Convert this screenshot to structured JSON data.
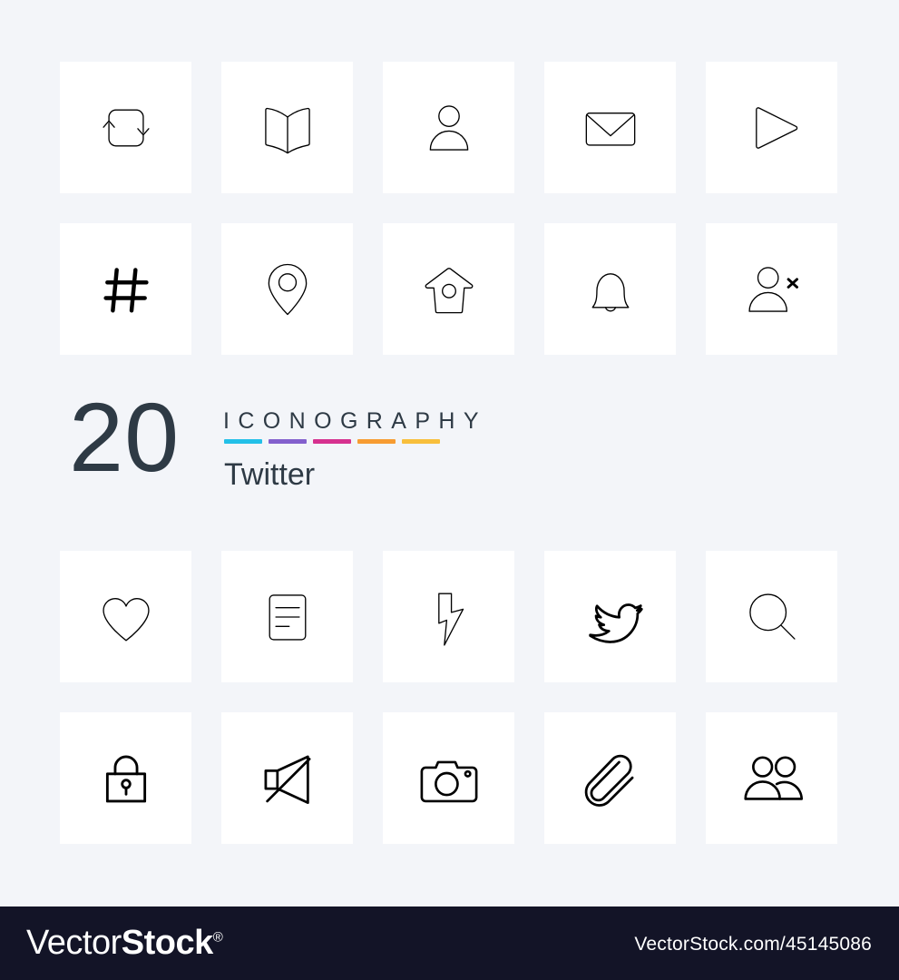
{
  "page": {
    "background_color": "#f3f5f9",
    "card_color": "#ffffff",
    "icon_stroke_color": "#000000"
  },
  "title_block": {
    "count": "20",
    "heading": "ICONOGRAPHY",
    "category": "Twitter",
    "text_color": "#2e3a45",
    "color_bars": [
      {
        "name": "bar-cyan",
        "color": "#23c0e8"
      },
      {
        "name": "bar-purple",
        "color": "#8360cd"
      },
      {
        "name": "bar-magenta",
        "color": "#d6318f"
      },
      {
        "name": "bar-orange",
        "color": "#f79c32"
      },
      {
        "name": "bar-yellow",
        "color": "#f8bf3c"
      }
    ]
  },
  "icons_top": [
    {
      "name": "retweet-icon",
      "label": "Retweet"
    },
    {
      "name": "book-icon",
      "label": "Book"
    },
    {
      "name": "user-icon",
      "label": "User"
    },
    {
      "name": "envelope-icon",
      "label": "Message"
    },
    {
      "name": "play-icon",
      "label": "Play"
    },
    {
      "name": "hashtag-icon",
      "label": "Hashtag"
    },
    {
      "name": "location-pin-icon",
      "label": "Location"
    },
    {
      "name": "birdhouse-icon",
      "label": "Birdhouse"
    },
    {
      "name": "bell-icon",
      "label": "Notification"
    },
    {
      "name": "user-remove-icon",
      "label": "Unfollow"
    }
  ],
  "icons_bottom": [
    {
      "name": "heart-icon",
      "label": "Like"
    },
    {
      "name": "document-icon",
      "label": "Document"
    },
    {
      "name": "lightning-icon",
      "label": "Moments"
    },
    {
      "name": "twitter-bird-icon",
      "label": "Twitter"
    },
    {
      "name": "search-icon",
      "label": "Search"
    },
    {
      "name": "lock-icon",
      "label": "Private"
    },
    {
      "name": "mute-icon",
      "label": "Mute"
    },
    {
      "name": "camera-icon",
      "label": "Camera"
    },
    {
      "name": "paperclip-icon",
      "label": "Attachment"
    },
    {
      "name": "users-group-icon",
      "label": "Followers"
    }
  ],
  "footer": {
    "brand_light": "Vector",
    "brand_bold": "Stock",
    "registered_mark": "®",
    "url": "VectorStock.com/45145086",
    "background_color": "#131427",
    "text_color": "#ffffff"
  }
}
